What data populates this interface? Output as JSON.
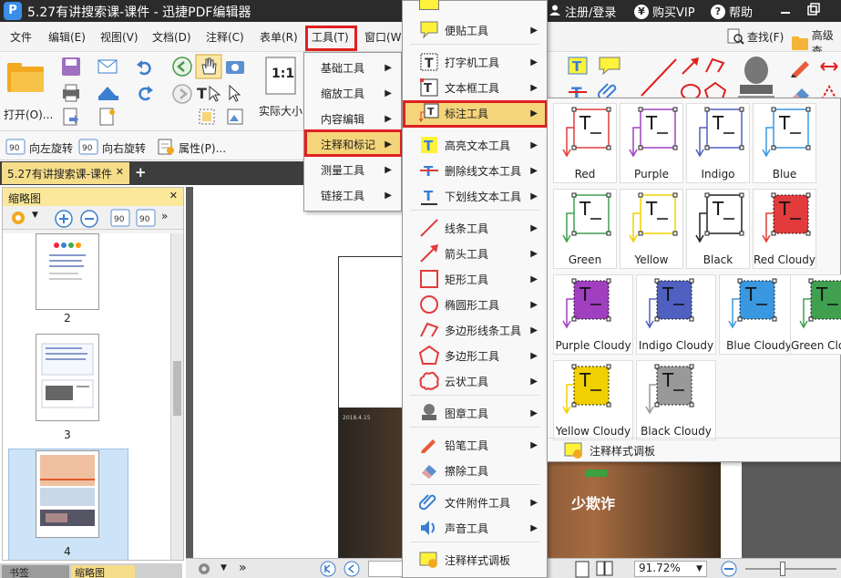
{
  "titlebar": {
    "title": "5.27有讲搜索课-课件 - 迅捷PDF编辑器",
    "register": "注册/登录",
    "buy": "购买VIP",
    "help": "帮助"
  },
  "menubar": {
    "items": [
      "文件",
      "编辑(E)",
      "视图(V)",
      "文档(D)",
      "注释(C)",
      "表单(R)",
      "工具(T)",
      "窗口(W"
    ],
    "right_find": "查找(F)",
    "right_adv": "高级查"
  },
  "ribbon": {
    "open_label": "打开(O)...",
    "actual_size": "实际大小",
    "actual_icon_text": "1:1"
  },
  "bar3": {
    "rotate_left": "向左旋转",
    "rotate_right": "向右旋转",
    "properties": "属性(P)..."
  },
  "tabbar": {
    "doc_tab": "5.27有讲搜索课-课件"
  },
  "thumb_panel": {
    "title": "缩略图",
    "pages": [
      "2",
      "3",
      "4"
    ]
  },
  "bottom_tabs": {
    "bookmarks": "书签",
    "thumbnails": "缩略图"
  },
  "statusbar": {
    "zoom": "91.72%"
  },
  "page_content": {
    "slogan": "少欺诈",
    "footer_text": "2018.4.15"
  },
  "menu_tools": {
    "items": [
      "基础工具",
      "缩放工具",
      "内容编辑",
      "注释和标记",
      "测量工具",
      "链接工具"
    ]
  },
  "menu_annot": {
    "items": [
      "便贴工具",
      "打字机工具",
      "文本框工具",
      "标注工具",
      "高亮文本工具",
      "删除线文本工具",
      "下划线文本工具",
      "线条工具",
      "箭头工具",
      "矩形工具",
      "椭圆形工具",
      "多边形线条工具",
      "多边形工具",
      "云状工具",
      "图章工具",
      "铅笔工具",
      "擦除工具",
      "文件附件工具",
      "声音工具",
      "注释样式调板"
    ]
  },
  "callout_panel": {
    "swatches": [
      "Red",
      "Purple",
      "Indigo",
      "Blue",
      "Green",
      "Yellow",
      "Black",
      "Red Cloudy",
      "Purple Cloudy",
      "Indigo Cloudy",
      "Blue Cloudy",
      "Green Clo",
      "Yellow Cloudy",
      "Black Cloudy"
    ],
    "footer": "注释样式调板"
  },
  "colors": {
    "red": "#e23b3b",
    "purple": "#a040c0",
    "indigo": "#5060c0",
    "blue": "#3a98e0",
    "green": "#40a050",
    "yellow": "#f0d000",
    "black": "#222222",
    "highlight": "#f5d57a",
    "menu_red": "#e02020"
  }
}
